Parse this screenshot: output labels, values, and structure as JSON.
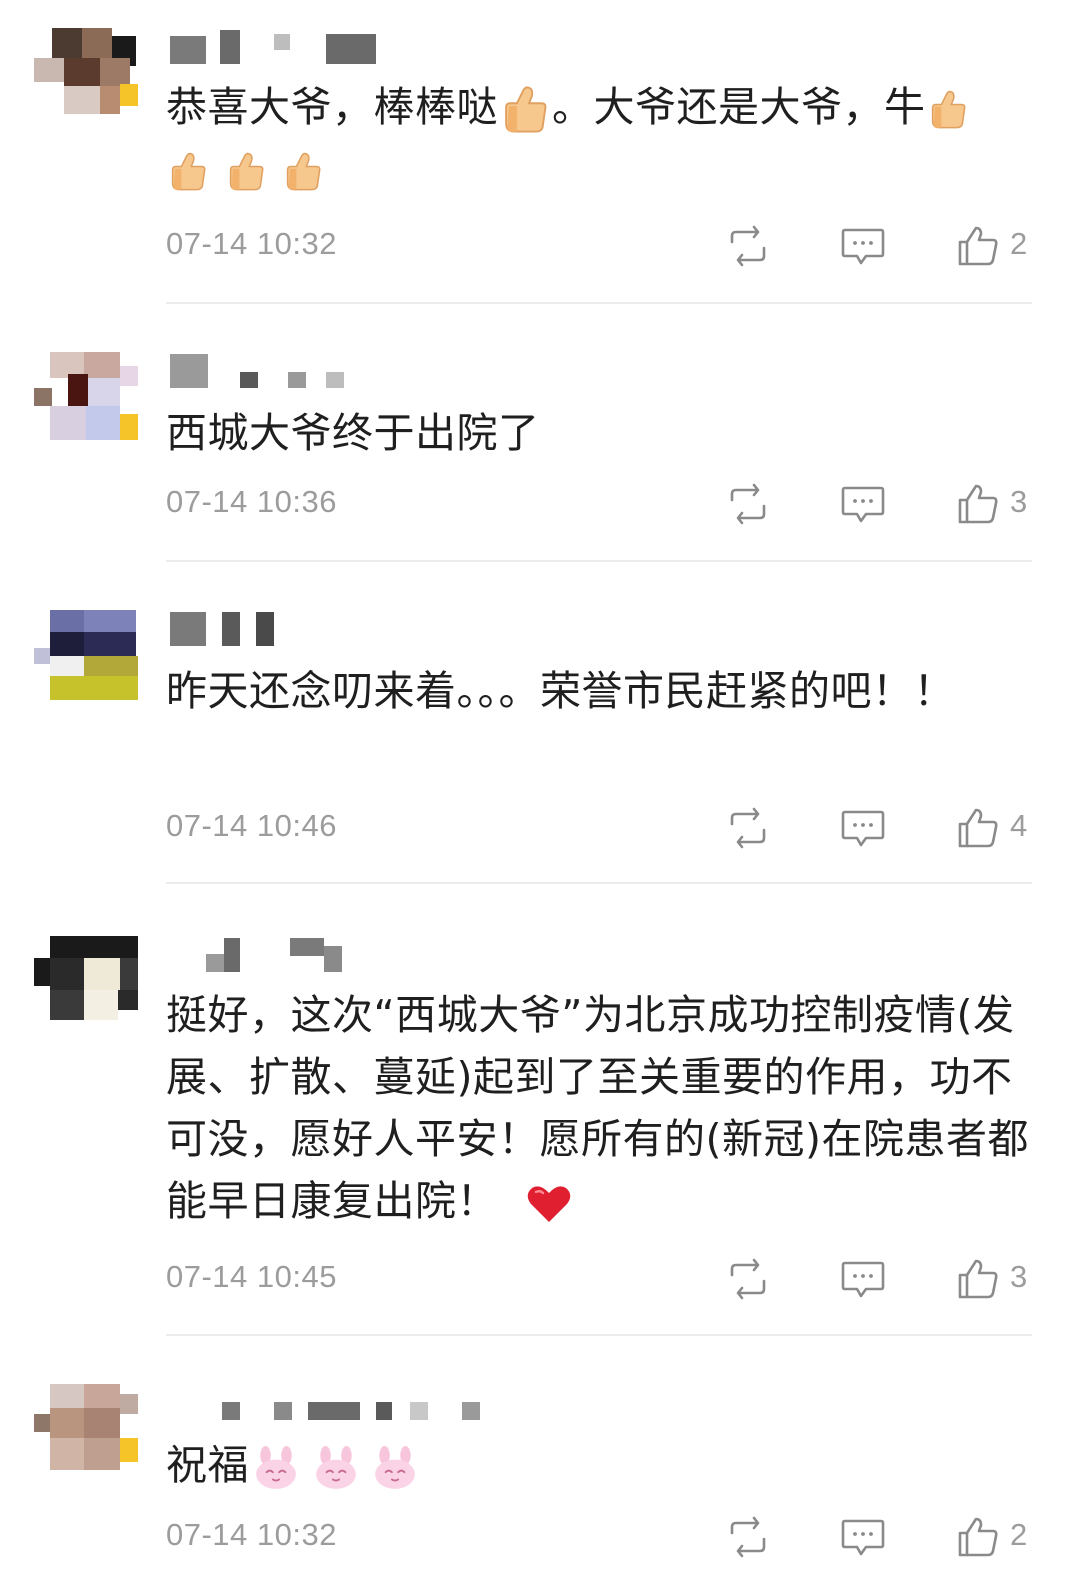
{
  "comments": [
    {
      "text": "恭喜大爷，棒棒哒",
      "text2": "。大爷还是大爷，牛",
      "time": "07-14 10:32",
      "likes": "2",
      "emojis": [
        "thumbs-up",
        "thumbs-up",
        "thumbs-up",
        "thumbs-up",
        "thumbs-up"
      ]
    },
    {
      "text": "西城大爷终于出院了",
      "time": "07-14 10:36",
      "likes": "3"
    },
    {
      "text": "昨天还念叨来着。。。荣誉市民赶紧的吧！！",
      "time": "07-14 10:46",
      "likes": "4"
    },
    {
      "text": "挺好，这次“西城大爷”为北京成功控制疫情(发展、扩散、蔓延)起到了至关重要的作用，功不可没，愿好人平安！愿所有的(新冠)在院患者都能早日康复出院！",
      "time": "07-14 10:45",
      "likes": "3",
      "emojis": [
        "red-heart"
      ]
    },
    {
      "text": "祝福",
      "time": "07-14 10:32",
      "likes": "2",
      "emojis": [
        "bunny-face",
        "bunny-face",
        "bunny-face"
      ]
    }
  ],
  "colors": {
    "meta_gray": "#9c9c9c",
    "divider": "#ececec",
    "heart": "#e02030",
    "thumb": "#f4b53f"
  }
}
